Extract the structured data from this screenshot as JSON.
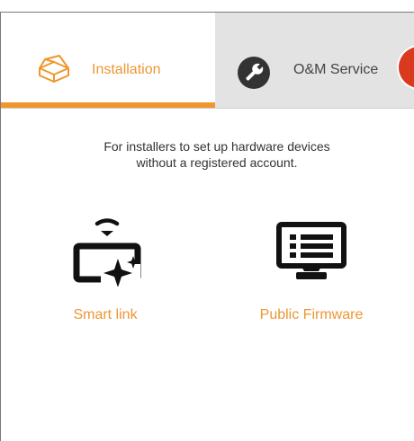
{
  "tabs": [
    {
      "label": "Installation",
      "icon": "box-icon",
      "active": true
    },
    {
      "label": "O&M Service",
      "icon": "wrench-icon",
      "active": false
    }
  ],
  "description": {
    "line1": "For installers to set up hardware devices",
    "line2": "without a registered account."
  },
  "options": [
    {
      "label": "Smart link",
      "icon": "smart-link-icon"
    },
    {
      "label": "Public Firmware",
      "icon": "firmware-monitor-icon"
    }
  ],
  "colors": {
    "accent": "#ee9632",
    "tab_inactive_bg": "#e3e3e3",
    "badge": "#d93a1e"
  }
}
